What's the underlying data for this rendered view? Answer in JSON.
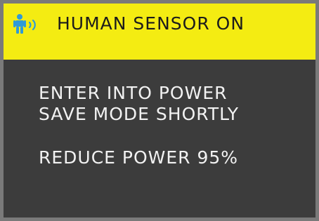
{
  "osd": {
    "header": {
      "icon": "human-sensor-icon",
      "title": "HUMAN SENSOR ON"
    },
    "message": {
      "line1": "ENTER INTO POWER",
      "line2": "SAVE MODE SHORTLY",
      "line3": "REDUCE POWER 95%"
    },
    "colors": {
      "header_background": "#f4ec12",
      "body_background": "#3c3c3c",
      "icon": "#2f9ad8",
      "text_dark": "#1c1c1c",
      "text_light": "#f2f2f2",
      "frame": "#7a7a7a"
    }
  }
}
